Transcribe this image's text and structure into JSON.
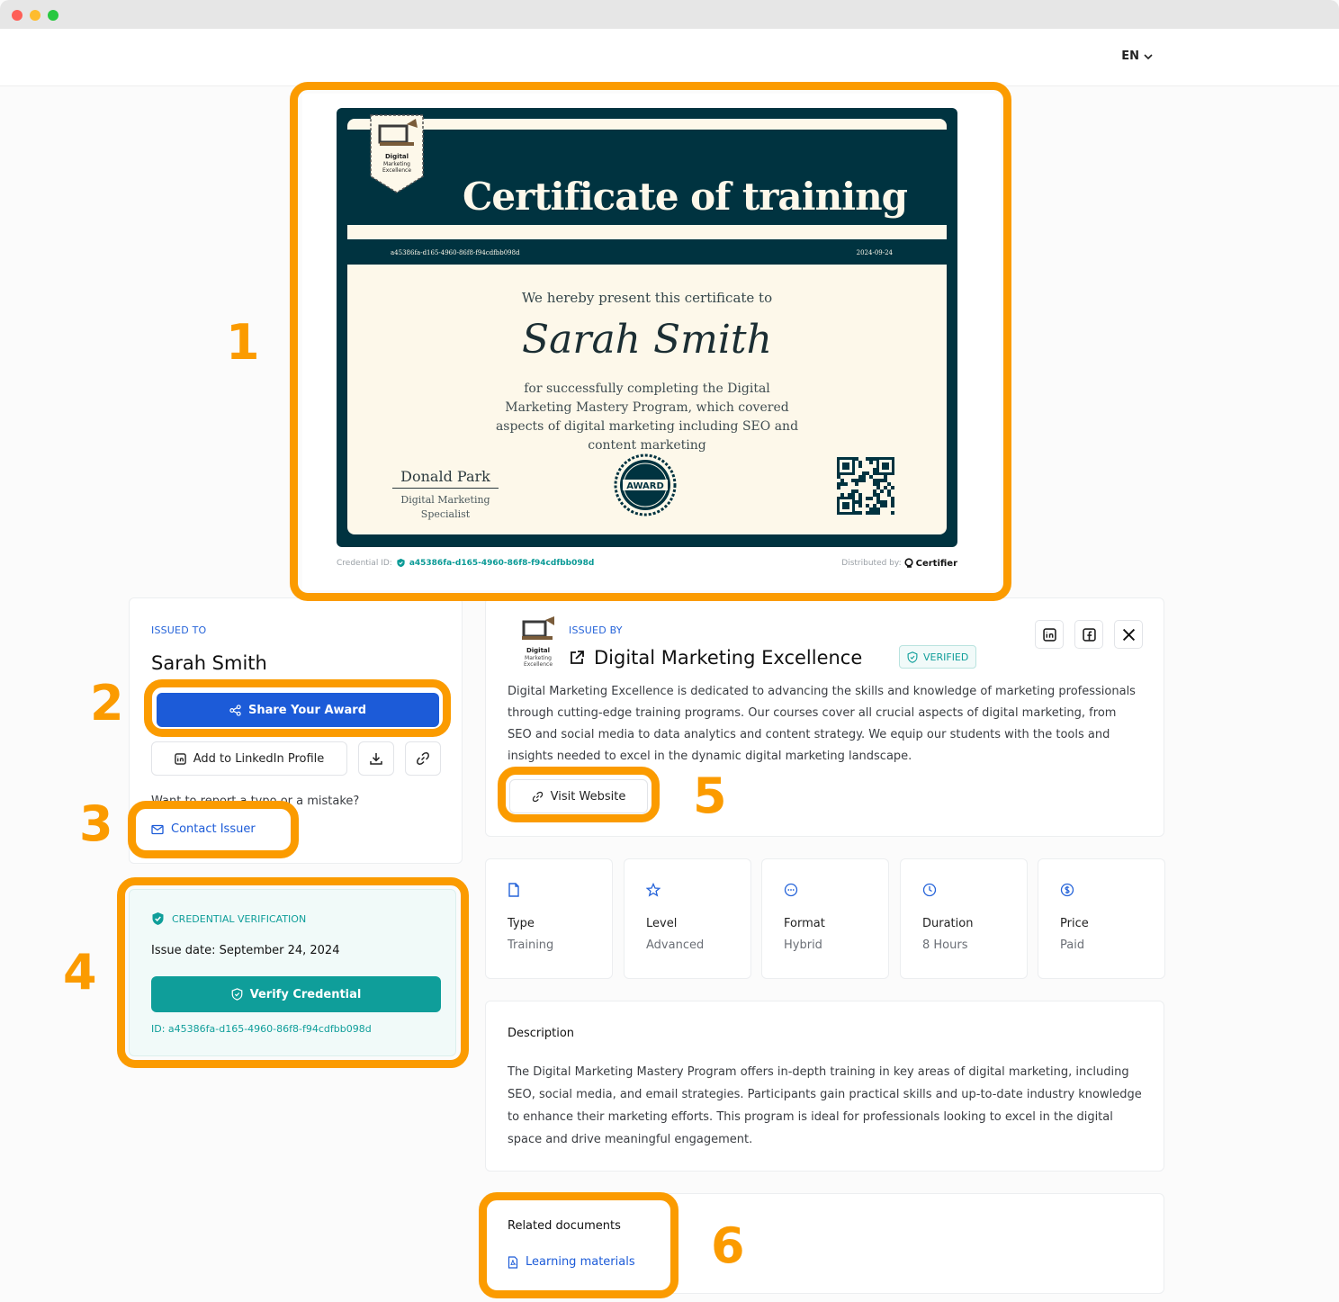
{
  "header": {
    "language": "EN"
  },
  "certificate": {
    "title": "Certificate of training",
    "badge_text": [
      "Digital",
      "Marketing",
      "Excellence"
    ],
    "cert_id_small": "a45386fa-d165-4960-86f8-f94cdfbb098d",
    "date_small": "2024-09-24",
    "present_text": "We hereby present this certificate to",
    "recipient": "Sarah Smith",
    "description": "for successfully completing the Digital Marketing Mastery Program, which covered aspects of digital marketing including SEO and content marketing",
    "signer_name": "Donald Park",
    "signer_role": "Digital Marketing Specialist",
    "award_text": "AWARD",
    "credential_label": "Credential ID:",
    "credential_id": "a45386fa-d165-4960-86f8-f94cdfbb098d",
    "distributed_label": "Distributed by:",
    "distributor": "Certifier"
  },
  "issued_to": {
    "label": "ISSUED TO",
    "name": "Sarah Smith",
    "share_button": "Share Your Award",
    "linkedin_button": "Add to LinkedIn Profile",
    "report_text": "Want to report a typo or a mistake?",
    "contact_button": "Contact Issuer"
  },
  "verification": {
    "label": "CREDENTIAL VERIFICATION",
    "issue_label": "Issue date:",
    "issue_date": "September 24, 2024",
    "verify_button": "Verify Credential",
    "id_text": "ID: a45386fa-d165-4960-86f8-f94cdfbb098d"
  },
  "issuer": {
    "label": "ISSUED BY",
    "name": "Digital Marketing Excellence",
    "verified": "VERIFIED",
    "logo_text": [
      "Digital",
      "Marketing",
      "Excellence"
    ],
    "about": "Digital Marketing Excellence is dedicated to advancing the skills and knowledge of marketing professionals through cutting-edge training programs. Our courses cover all crucial aspects of digital marketing, from SEO and social media to data analytics and content strategy. We equip our students with the tools and insights needed to excel in the dynamic digital marketing landscape.",
    "website_button": "Visit Website"
  },
  "details": [
    {
      "title": "Type",
      "value": "Training",
      "icon": "document-icon"
    },
    {
      "title": "Level",
      "value": "Advanced",
      "icon": "star-icon"
    },
    {
      "title": "Format",
      "value": "Hybrid",
      "icon": "chat-icon"
    },
    {
      "title": "Duration",
      "value": "8 Hours",
      "icon": "clock-icon"
    },
    {
      "title": "Price",
      "value": "Paid",
      "icon": "dollar-icon"
    }
  ],
  "description": {
    "title": "Description",
    "text": "The Digital Marketing Mastery Program offers in-depth training in key areas of digital marketing, including SEO, social media, and email strategies. Participants gain practical skills and up-to-date industry knowledge to enhance their marketing efforts. This program is ideal for professionals looking to excel in the digital space and drive meaningful engagement."
  },
  "related": {
    "title": "Related documents",
    "link": "Learning materials"
  },
  "annotations": [
    "1",
    "2",
    "3",
    "4",
    "5",
    "6"
  ],
  "colors": {
    "highlight": "#fb9b00",
    "primary": "#1c5bd8",
    "teal": "#0f9e9a",
    "cert_dark": "#003340",
    "cert_paper": "#fdf8ea"
  }
}
